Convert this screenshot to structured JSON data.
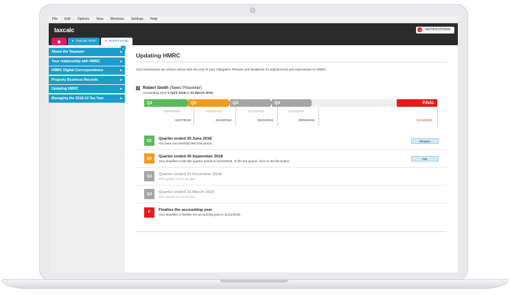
{
  "menu": [
    "File",
    "Edit",
    "Options",
    "View",
    "Windows",
    "Settings",
    "Help"
  ],
  "app": {
    "logo": "taxcalc",
    "notifications_count": "3",
    "notifications_label": "NOTIFICATIONS"
  },
  "tabs": {
    "mtd": "TaxCalc MTD",
    "client": "Robert Smith"
  },
  "sidebar": [
    "About the Taxpayer",
    "Your relationship with HMRC",
    "HMRC Digital Correspondence",
    "Property Business Records",
    "Updating HMRC",
    "Managing the 2018-19 Tax Year"
  ],
  "page": {
    "title": "Updating HMRC",
    "intro": "Your businesses are shown below with the end of your Obligation Periods and deadlines for adjustments and submission to HMRC.",
    "person_name": "Robert Smith",
    "person_role": "(News Presenter)",
    "period_prefix": "Accounting year",
    "period_start": "1 April 2018",
    "period_to": "to",
    "period_end": "31 March 2019"
  },
  "timeline": {
    "labels": [
      "Q1",
      "Q2",
      "Q3",
      "Q4",
      "FINAL"
    ],
    "due_dates": [
      "30/06/2018",
      "30/09/2018",
      "31/12/2018",
      "31/03/2019"
    ],
    "end_dates": [
      "31/07/2018",
      "31/10/2018",
      "31/01/2019",
      "30/04/2019",
      "31/12/2019"
    ]
  },
  "quarters": [
    {
      "badge": "Q1",
      "title": "Quarter ended 30 June 2018",
      "sub": "You have successfully filed this period.",
      "button": "Reopen"
    },
    {
      "badge": "Q2",
      "title": "Quarter ended 30 September 2018",
      "sub": "Your deadline to file this quarter period is 31/10/2018. To file the period, click on the file button.",
      "button": "File"
    },
    {
      "badge": "Q3",
      "title": "Quarter ended 31 December 2018",
      "sub": "This quarter is not yet due."
    },
    {
      "badge": "Q4",
      "title": "Quarter ended 31 March 2019",
      "sub": "This quarter is not yet due."
    },
    {
      "badge": "F",
      "title": "Finalise the accounting year",
      "sub": "Your deadline to finalise the accounting year is 31/12/2019."
    }
  ],
  "colors": {
    "q1": "#5cb85c",
    "q2": "#f39a1e",
    "q_pending": "#a5a5a5",
    "final": "#e51b1b",
    "accent": "#1a9ccd"
  }
}
